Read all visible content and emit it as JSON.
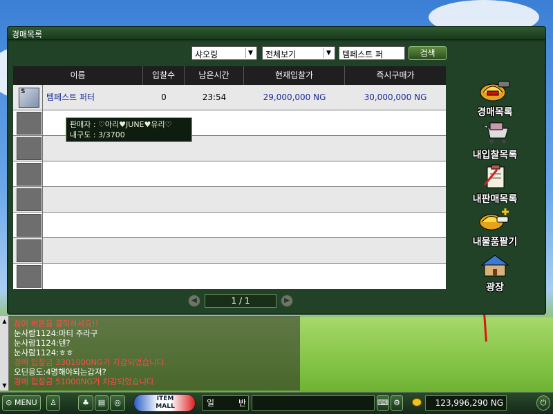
{
  "window": {
    "title": "경매목록"
  },
  "filters": {
    "category": "샤오링",
    "view": "전체보기",
    "search_value": "템페스트 퍼",
    "search_button": "검색"
  },
  "table": {
    "headers": [
      "이름",
      "입찰수",
      "남은시간",
      "현재입찰가",
      "즉시구매가"
    ],
    "rows": [
      {
        "name": "템페스트 퍼터",
        "bids": "0",
        "time_left": "23:54",
        "current_bid": "29,000,000 NG",
        "buy_now": "30,000,000 NG"
      }
    ]
  },
  "tooltip": {
    "seller": "판매자 : ♡아리♥JUNE♥유리♡",
    "durability": "내구도 : 3/3700"
  },
  "pager": {
    "label": "1 / 1"
  },
  "side_menu": {
    "auction_list": "경매목록",
    "my_bids": "내입찰목록",
    "my_sales": "내판매목록",
    "sell_item": "내물품팔기",
    "plaza": "광장"
  },
  "chat": [
    {
      "text": "참여 버튼을 클릭하세요!!",
      "color": "#ff4a4a"
    },
    {
      "text": "눈사람1124:마티 주라구",
      "color": "#ffffff"
    },
    {
      "text": "눈사람1124:텐?",
      "color": "#ffffff"
    },
    {
      "text": "눈사람1124:ㅎㅎ",
      "color": "#ffffff"
    },
    {
      "text": "경매 입찰금  3301000NG가 차감되었습니다.",
      "color": "#ff4a4a"
    },
    {
      "text": "오딘응도:4명해야되는갑져?",
      "color": "#ffffff"
    },
    {
      "text": "경매 입찰금  51000NG가 차감되었습니다.",
      "color": "#ff4a4a"
    }
  ],
  "bottombar": {
    "menu_label": "MENU",
    "item_mall_top": "ITEM",
    "item_mall_bottom": "MALL",
    "chat_mode_1": "일",
    "chat_mode_2": "반",
    "money": "123,996,290 NG"
  }
}
